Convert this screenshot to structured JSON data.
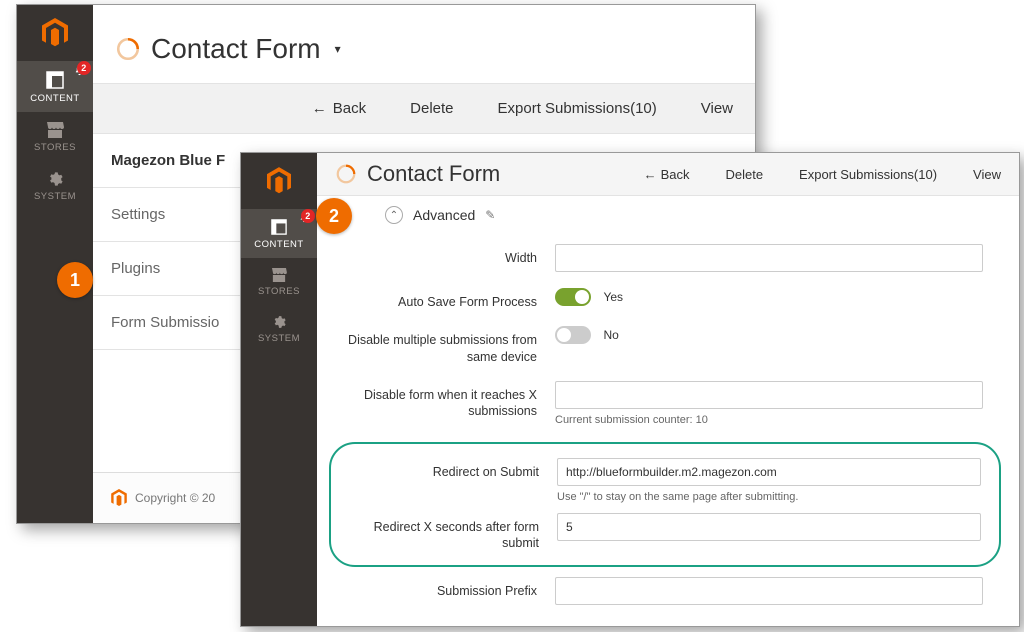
{
  "colors": {
    "accent": "#ef6c00",
    "brand": "#ef6c00",
    "toggle_on": "#79a22e",
    "highlight_border": "#1ba184",
    "badge": "#e22626"
  },
  "markers": {
    "one": "1",
    "two": "2"
  },
  "panel_a": {
    "title": "Contact Form",
    "sidebar": {
      "badge": "2",
      "items": [
        {
          "label": "CONTENT"
        },
        {
          "label": "STORES"
        },
        {
          "label": "SYSTEM"
        }
      ]
    },
    "actions": {
      "back": "Back",
      "delete": "Delete",
      "export": "Export Submissions(10)",
      "view": "View"
    },
    "tabs": {
      "heading": "Magezon Blue F",
      "items": [
        {
          "label": "Settings"
        },
        {
          "label": "Plugins"
        },
        {
          "label": "Form Submissio"
        }
      ]
    },
    "footer": "Copyright © 20"
  },
  "panel_b": {
    "title": "Contact Form",
    "sidebar": {
      "badge": "2",
      "items": [
        {
          "label": "CONTENT"
        },
        {
          "label": "STORES"
        },
        {
          "label": "SYSTEM"
        }
      ]
    },
    "actions": {
      "back": "Back",
      "delete": "Delete",
      "export": "Export Submissions(10)",
      "view": "View"
    },
    "section": {
      "title": "Advanced"
    },
    "form": {
      "width": {
        "label": "Width",
        "value": ""
      },
      "autosave": {
        "label": "Auto Save Form Process",
        "state": "Yes"
      },
      "disable_multi": {
        "label": "Disable multiple submissions from same device",
        "state": "No"
      },
      "disable_reach": {
        "label": "Disable form when it reaches X submissions",
        "value": "",
        "helper": "Current submission counter: 10"
      },
      "redirect": {
        "label": "Redirect on Submit",
        "value": "http://blueformbuilder.m2.magezon.com",
        "helper": "Use \"/\" to stay on the same page after submitting."
      },
      "redirect_delay": {
        "label": "Redirect X seconds after form submit",
        "value": "5"
      },
      "prefix": {
        "label": "Submission Prefix",
        "value": ""
      }
    }
  }
}
